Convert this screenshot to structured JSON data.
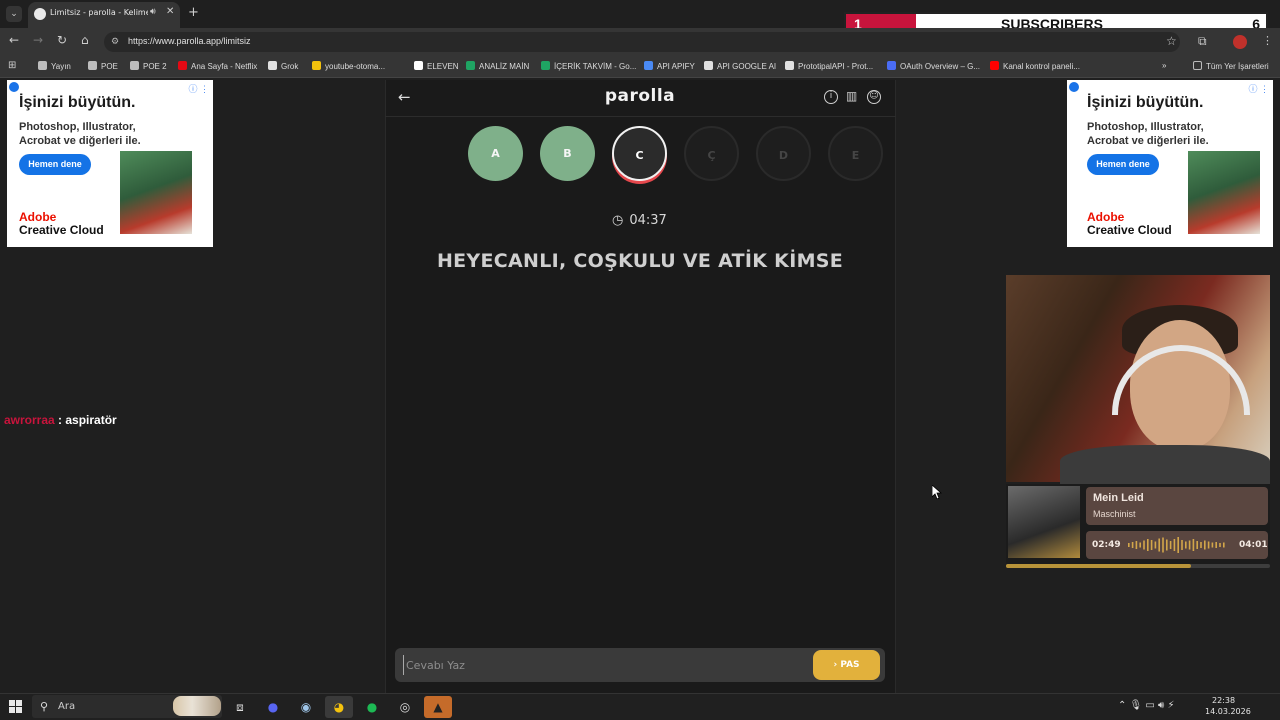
{
  "browser": {
    "tab_title": "Limitsiz - parolla - Kelime o",
    "url": "https://www.parolla.app/limitsiz",
    "bookmarks": [
      {
        "label": "Yayın",
        "color": "#bdbdbd"
      },
      {
        "label": "POE",
        "color": "#bdbdbd"
      },
      {
        "label": "POE 2",
        "color": "#bdbdbd"
      },
      {
        "label": "Ana Sayfa - Netflix",
        "color": "#e50914"
      },
      {
        "label": "Grok",
        "color": "#e0e0e0"
      },
      {
        "label": "youtube-otoma...",
        "color": "#f4c20d"
      },
      {
        "label": "ELEVEN",
        "color": "#ffffff"
      },
      {
        "label": "ANALİZ MAİN",
        "color": "#1fa463"
      },
      {
        "label": "İÇERİK TAKVİM - Go...",
        "color": "#1fa463"
      },
      {
        "label": "API APIFY",
        "color": "#4a8af4"
      },
      {
        "label": "API GOOGLE AI",
        "color": "#e0e0e0"
      },
      {
        "label": "PrototipalAPI - Prot...",
        "color": "#e0e0e0"
      },
      {
        "label": "OAuth Overview – G...",
        "color": "#4a6cf4"
      },
      {
        "label": "Kanal kontrol paneli...",
        "color": "#ff0000"
      }
    ],
    "more_label": "»",
    "all_bookmarks": "Tüm Yer İşaretleri"
  },
  "subscribers": {
    "current": "1",
    "label": "SUBSCRIBERS",
    "goal": "6",
    "fill_fraction": 0.167
  },
  "ad": {
    "headline": "İşinizi büyütün.",
    "line1": "Photoshop, Illustrator,",
    "line2": "Acrobat ve diğerleri ile.",
    "cta": "Hemen dene",
    "brand1": "Adobe",
    "brand2": "Creative Cloud"
  },
  "game": {
    "logo": "parolla",
    "letters": [
      {
        "char": "A",
        "state": "done"
      },
      {
        "char": "B",
        "state": "done"
      },
      {
        "char": "C",
        "state": "current"
      },
      {
        "char": "Ç",
        "state": "pending"
      },
      {
        "char": "D",
        "state": "pending"
      },
      {
        "char": "E",
        "state": "pending"
      }
    ],
    "timer": "04:37",
    "question": "HEYECANLI, COŞKULU VE ATİK KİMSE",
    "answer_placeholder": "Cevabı Yaz",
    "pass_label": "PAS"
  },
  "chat": {
    "user": "awrorraa",
    "separator": " : ",
    "message": "aspiratör"
  },
  "music": {
    "title": "Mein Leid",
    "artist": "Maschinist",
    "elapsed": "02:49",
    "total": "04:01",
    "progress_fraction": 0.7
  },
  "taskbar": {
    "search_placeholder": "Ara",
    "time": "22:38",
    "date": "14.03.2026"
  },
  "colors": {
    "accent_red": "#c8143c",
    "done_green": "#7fb08a",
    "pass_yellow": "#e2b13c"
  }
}
